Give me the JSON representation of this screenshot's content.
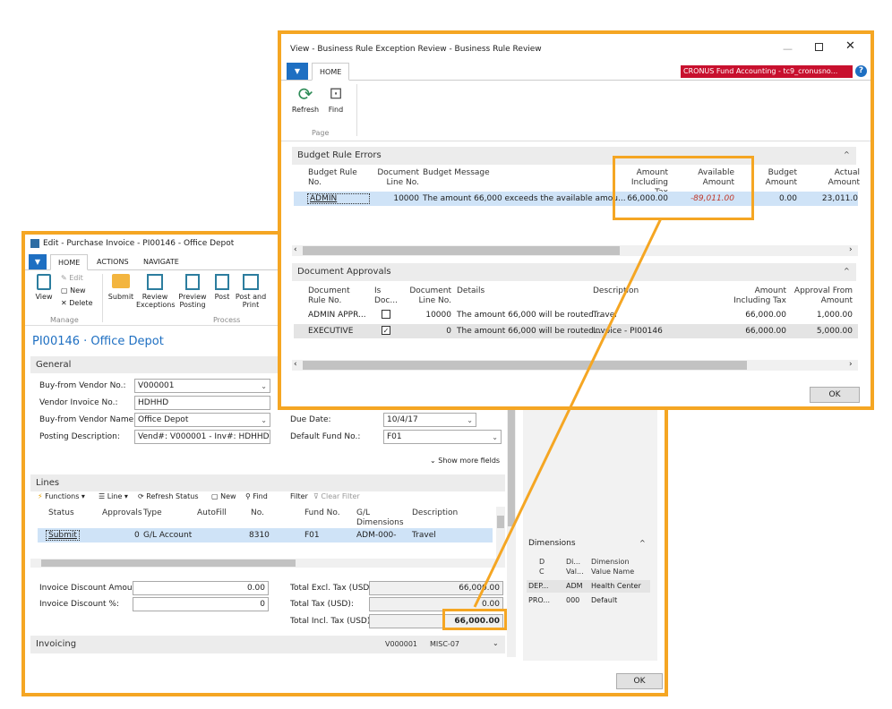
{
  "purchase_invoice": {
    "window_title": "Edit - Purchase Invoice - PI00146 - Office Depot",
    "tabs": [
      "HOME",
      "ACTIONS",
      "NAVIGATE"
    ],
    "ribbon": {
      "view": "View",
      "edit": "Edit",
      "new": "New",
      "delete": "Delete",
      "manage_group": "Manage",
      "submit": "Submit",
      "review_exceptions": "Review Exceptions",
      "preview_posting": "Preview Posting",
      "post": "Post",
      "post_and_print": "Post and Print",
      "process_group": "Process"
    },
    "page_title": "PI00146 · Office Depot",
    "general_section": "General",
    "fields": {
      "buy_from_vendor_no_label": "Buy-from Vendor No.:",
      "buy_from_vendor_no": "V000001",
      "vendor_invoice_no_label": "Vendor Invoice No.:",
      "vendor_invoice_no": "HDHHD",
      "buy_from_vendor_name_label": "Buy-from Vendor Name:",
      "buy_from_vendor_name": "Office Depot",
      "posting_description_label": "Posting Description:",
      "posting_description": "Vend#: V000001 - Inv#: HDHHD",
      "due_date_label": "Due Date:",
      "due_date": "10/4/17",
      "default_fund_no_label": "Default Fund No.:",
      "default_fund_no": "F01"
    },
    "show_more_fields": "Show more fields",
    "lines_section": "Lines",
    "lines_toolbar": [
      "Functions",
      "Line",
      "Refresh Status",
      "New",
      "Find",
      "Filter",
      "Clear Filter"
    ],
    "lines_columns": [
      "Status",
      "Approvals",
      "Type",
      "AutoFill",
      "No.",
      "Fund No.",
      "G/L Dimensions",
      "Description"
    ],
    "lines_rows": [
      {
        "status": "Submit",
        "approvals": "0",
        "type": "G/L Account",
        "no": "8310",
        "fund": "F01",
        "gl_dims": "ADM-000-",
        "description": "Travel"
      }
    ],
    "totals": {
      "invoice_discount_amount_label": "Invoice Discount Amount:",
      "invoice_discount_amount": "0.00",
      "invoice_discount_pct_label": "Invoice Discount %:",
      "invoice_discount_pct": "0",
      "total_excl_tax_label": "Total Excl. Tax (USD):",
      "total_excl_tax": "66,000.00",
      "total_tax_label": "Total Tax (USD):",
      "total_tax": "0.00",
      "total_incl_tax_label": "Total Incl. Tax (USD):",
      "total_incl_tax": "66,000.00"
    },
    "invoicing_section": "Invoicing",
    "invoicing_vendor": "V000001",
    "invoicing_misc": "MISC-07",
    "dimensions": {
      "title": "Dimensions",
      "col1": "D C",
      "col2": "Di... Val...",
      "col3": "Dimension Value Name",
      "rows": [
        {
          "c1": "DEP...",
          "c2": "ADM",
          "c3": "Health Center"
        },
        {
          "c1": "PRO...",
          "c2": "000",
          "c3": "Default"
        }
      ]
    },
    "ok": "OK"
  },
  "exception_review": {
    "window_title": "View - Business Rule Exception Review - Business Rule Review",
    "tab": "HOME",
    "company": "CRONUS Fund Accounting - tc9_cronusno...",
    "refresh": "Refresh",
    "find": "Find",
    "page_group": "Page",
    "budget_rule_errors": "Budget Rule Errors",
    "budget_columns": [
      "Budget Rule No.",
      "Document Line No.",
      "Budget Message",
      "Amount Including Tax",
      "Available Amount",
      "Budget Amount",
      "Actual Amount"
    ],
    "budget_rows": [
      {
        "rule_no": "ADMIN",
        "line_no": "10000",
        "message": "The amount 66,000 exceeds the available amou...",
        "amount_incl_tax": "66,000.00",
        "available": "-89,011.00",
        "budget": "0.00",
        "actual": "23,011.0"
      }
    ],
    "document_approvals": "Document Approvals",
    "approval_columns": [
      "Document Rule No.",
      "Is Doc...",
      "Document Line No.",
      "Details",
      "Description",
      "Amount Including Tax",
      "Approval From Amount"
    ],
    "approval_rows": [
      {
        "rule_no": "ADMIN APPR...",
        "is_doc": false,
        "line_no": "10000",
        "details": "The amount 66,000 will be routed...",
        "description": "Travel",
        "amount": "66,000.00",
        "from_amount": "1,000.00"
      },
      {
        "rule_no": "EXECUTIVE",
        "is_doc": true,
        "line_no": "0",
        "details": "The amount 66,000 will be routed...",
        "description": "Invoice - PI00146",
        "amount": "66,000.00",
        "from_amount": "5,000.00"
      }
    ],
    "ok": "OK"
  },
  "colors": {
    "highlight": "#f5a623",
    "accent": "#1e6fc2",
    "negative": "#c0392b",
    "selected_row": "#cfe3f7"
  }
}
